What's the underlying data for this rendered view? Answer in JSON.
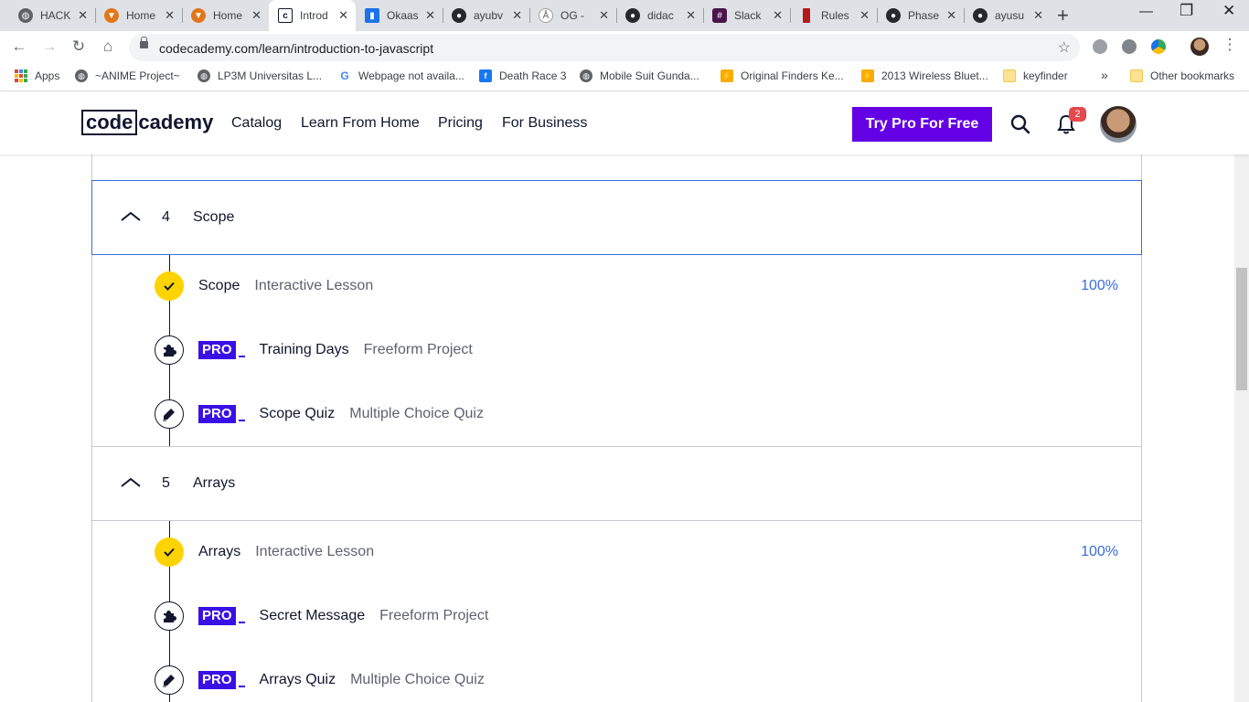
{
  "browser": {
    "tabs": [
      {
        "title": "HACK",
        "icon": "globe-icon",
        "color": "#5f6368"
      },
      {
        "title": "Home",
        "icon": "fox-icon",
        "color": "#e2761b"
      },
      {
        "title": "Home",
        "icon": "fox-icon",
        "color": "#e2761b"
      },
      {
        "title": "Introd",
        "icon": "codecademy-icon",
        "color": "#10162f"
      },
      {
        "title": "Okaas",
        "icon": "book-icon",
        "color": "#1a73e8"
      },
      {
        "title": "ayubv",
        "icon": "github-icon",
        "color": "#24292e"
      },
      {
        "title": "OG - ",
        "icon": "figure-icon",
        "color": "#9e9e9e"
      },
      {
        "title": "didac",
        "icon": "github-icon",
        "color": "#24292e"
      },
      {
        "title": "Slack",
        "icon": "slack-icon",
        "color": "#4a154b"
      },
      {
        "title": "Rules",
        "icon": "bookmark-icon",
        "color": "#b31b1b"
      },
      {
        "title": "Phase",
        "icon": "github-icon",
        "color": "#24292e"
      },
      {
        "title": "ayusu",
        "icon": "github-icon",
        "color": "#24292e"
      }
    ],
    "url": "codecademy.com/learn/introduction-to-javascript",
    "bookmarks": [
      {
        "label": "Apps",
        "icon": "apps-grid-icon"
      },
      {
        "label": "~ANIME Project~",
        "icon": "globe-icon"
      },
      {
        "label": "LP3M Universitas L...",
        "icon": "globe-icon"
      },
      {
        "label": "Webpage not availa...",
        "icon": "google-icon"
      },
      {
        "label": "Death Race 3",
        "icon": "facebook-icon"
      },
      {
        "label": "Mobile Suit Gunda...",
        "icon": "globe-icon"
      },
      {
        "label": "Original Finders Ke...",
        "icon": "lightning-icon"
      },
      {
        "label": "2013 Wireless Bluet...",
        "icon": "lightning-icon"
      },
      {
        "label": "keyfinder",
        "icon": "folder-icon"
      }
    ],
    "bookmarks_overflow": "»",
    "other_bookmarks": "Other bookmarks"
  },
  "header": {
    "logo_box": "code",
    "logo_rest": "cademy",
    "nav": [
      "Catalog",
      "Learn From Home",
      "Pricing",
      "For Business"
    ],
    "cta": "Try Pro For Free",
    "notification_count": "2"
  },
  "syllabus": {
    "modules": [
      {
        "number": "4",
        "title": "Scope",
        "items": [
          {
            "name": "Scope",
            "type": "Interactive Lesson",
            "pro": false,
            "status": "done",
            "percent": "100%"
          },
          {
            "name": "Training Days",
            "type": "Freeform Project",
            "pro": true,
            "status": "project"
          },
          {
            "name": "Scope Quiz",
            "type": "Multiple Choice Quiz",
            "pro": true,
            "status": "quiz"
          }
        ]
      },
      {
        "number": "5",
        "title": "Arrays",
        "items": [
          {
            "name": "Arrays",
            "type": "Interactive Lesson",
            "pro": false,
            "status": "done",
            "percent": "100%"
          },
          {
            "name": "Secret Message",
            "type": "Freeform Project",
            "pro": true,
            "status": "project"
          },
          {
            "name": "Arrays Quiz",
            "type": "Multiple Choice Quiz",
            "pro": true,
            "status": "quiz"
          }
        ]
      }
    ],
    "pro_label": "PRO"
  }
}
